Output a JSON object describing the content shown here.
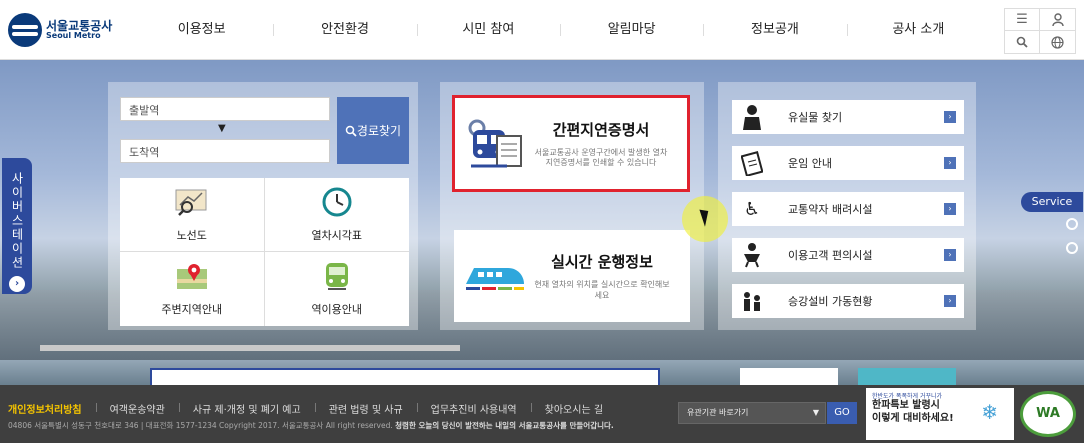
{
  "header": {
    "logo_ko": "서울교통공사",
    "logo_en": "Seoul Metro",
    "nav": [
      "이용정보",
      "안전환경",
      "시민 참여",
      "알림마당",
      "정보공개",
      "공사 소개"
    ],
    "util_icons": [
      "menu-icon",
      "user-icon",
      "search-icon",
      "globe-icon"
    ]
  },
  "side_tab": {
    "label": "사이버스테이션",
    "arrow": "›"
  },
  "route": {
    "from_placeholder": "출발역",
    "to_placeholder": "도착역",
    "arrow": "▼",
    "button_label": "경로찾기"
  },
  "quick_links": [
    {
      "label": "노선도",
      "icon": "route-map-icon"
    },
    {
      "label": "열차시각표",
      "icon": "clock-icon"
    },
    {
      "label": "주변지역안내",
      "icon": "map-pin-icon"
    },
    {
      "label": "역이용안내",
      "icon": "train-front-icon"
    }
  ],
  "cert_card": {
    "title": "간편지연증명서",
    "desc": "서울교통공사 운영구간에서 발생한 열차지연증명서를 인쇄할 수 있습니다"
  },
  "realtime_card": {
    "title": "실시간 운행정보",
    "desc": "현재 열차의 위치를 실시간으로 확인해보세요"
  },
  "services": [
    {
      "label": "유실물 찾기",
      "icon": "person-icon"
    },
    {
      "label": "운임 안내",
      "icon": "ticket-icon"
    },
    {
      "label": "교통약자 배려시설",
      "icon": "wheelchair-icon"
    },
    {
      "label": "이용고객 편의시설",
      "icon": "baby-care-icon"
    },
    {
      "label": "승강설비 가동현황",
      "icon": "elevator-icon"
    }
  ],
  "service_pill": "Service",
  "footer": {
    "links": [
      "개인정보처리방침",
      "여객운송약관",
      "사규 제·개정 및 폐기 예고",
      "관련 법령 및 사규",
      "업무추진비 사용내역",
      "찾아오시는 길"
    ],
    "copyright": "04806 서울특별시 성동구 천호대로 346 | 대표전화 1577-1234 Copyright 2017. 서울교통공사 All right reserved.",
    "slogan": "청렴한 오늘의 당신이 발전하는 내일의 서울교통공사를 만들어갑니다.",
    "select_label": "유관기관 바로가기",
    "go_label": "GO",
    "banner_small": "한반도가 폭폭하게 거꾸니가",
    "banner_line1": "한파특보 발령시",
    "banner_line2": "이렇게 대비하세요!",
    "wa_label": "WA"
  },
  "colors": {
    "brand": "#2d4a9c",
    "cert_border": "#e0222e",
    "accent_blue": "#4f72b8"
  }
}
